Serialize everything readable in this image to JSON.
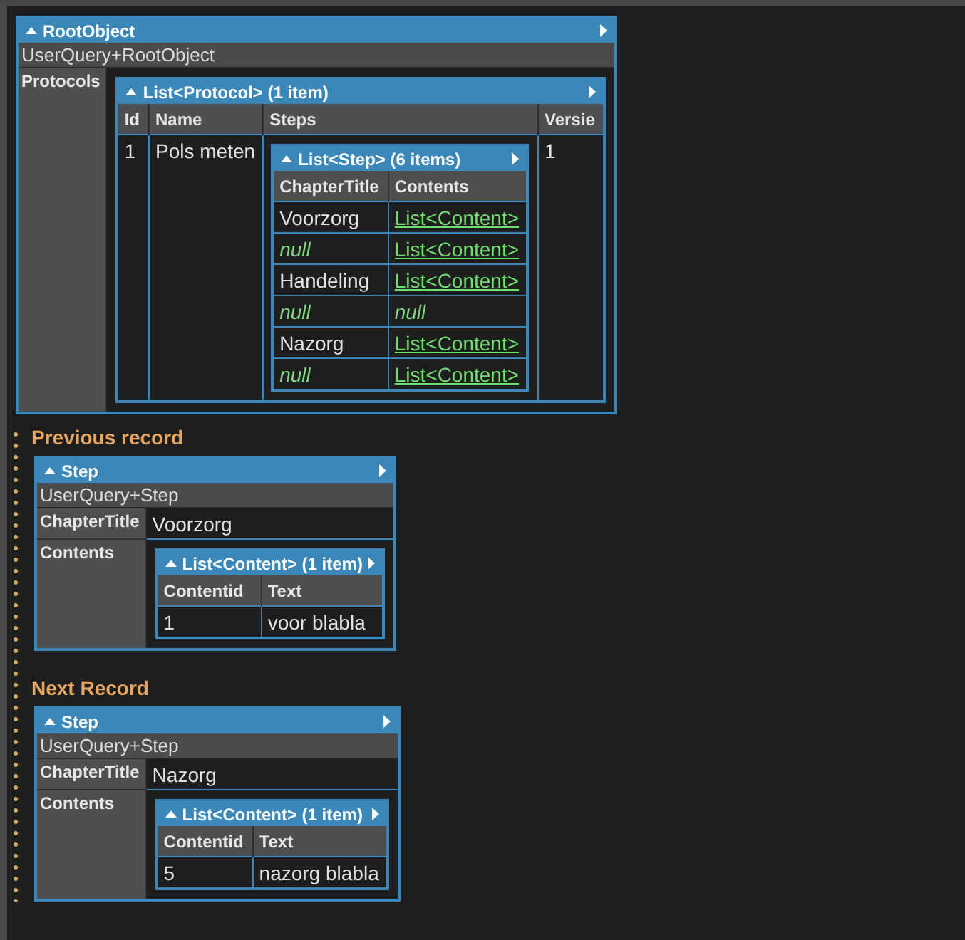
{
  "root": {
    "kind": "object",
    "title": "RootObject",
    "expanded": true,
    "type_name": "UserQuery+RootObject",
    "fields": [
      {
        "name": "Protocols",
        "value": {
          "kind": "table",
          "title": "List<Protocol> (1 item)",
          "expanded": true,
          "columns": [
            "Id",
            "Name",
            "Steps",
            "Versie"
          ],
          "rows": [
            [
              {
                "kind": "text",
                "text": "1"
              },
              {
                "kind": "text",
                "text": "Pols meten"
              },
              {
                "kind": "table",
                "title": "List<Step> (6 items)",
                "expanded": true,
                "columns": [
                  "ChapterTitle",
                  "Contents"
                ],
                "rows": [
                  [
                    {
                      "kind": "text",
                      "text": "Voorzorg"
                    },
                    {
                      "kind": "link",
                      "text": "List<Content>"
                    }
                  ],
                  [
                    {
                      "kind": "null",
                      "text": "null"
                    },
                    {
                      "kind": "link",
                      "text": "List<Content>"
                    }
                  ],
                  [
                    {
                      "kind": "text",
                      "text": "Handeling"
                    },
                    {
                      "kind": "link",
                      "text": "List<Content>"
                    }
                  ],
                  [
                    {
                      "kind": "null",
                      "text": "null"
                    },
                    {
                      "kind": "null",
                      "text": "null"
                    }
                  ],
                  [
                    {
                      "kind": "text",
                      "text": "Nazorg"
                    },
                    {
                      "kind": "link",
                      "text": "List<Content>"
                    }
                  ],
                  [
                    {
                      "kind": "null",
                      "text": "null"
                    },
                    {
                      "kind": "link",
                      "text": "List<Content>"
                    }
                  ]
                ]
              },
              {
                "kind": "text",
                "text": "1"
              }
            ]
          ]
        }
      }
    ]
  },
  "records": [
    {
      "heading": "Previous record",
      "object": {
        "kind": "object",
        "title": "Step",
        "expanded": true,
        "type_name": "UserQuery+Step",
        "fields": [
          {
            "name": "ChapterTitle",
            "value": {
              "kind": "text",
              "text": "Voorzorg"
            }
          },
          {
            "name": "Contents",
            "value": {
              "kind": "table",
              "title": "List<Content> (1 item)",
              "expanded": true,
              "columns": [
                "Contentid",
                "Text"
              ],
              "rows": [
                [
                  {
                    "kind": "text",
                    "text": "1"
                  },
                  {
                    "kind": "text",
                    "text": "voor blabla"
                  }
                ]
              ]
            }
          }
        ]
      }
    },
    {
      "heading": "Next Record",
      "object": {
        "kind": "object",
        "title": "Step",
        "expanded": true,
        "type_name": "UserQuery+Step",
        "fields": [
          {
            "name": "ChapterTitle",
            "value": {
              "kind": "text",
              "text": "Nazorg"
            }
          },
          {
            "name": "Contents",
            "value": {
              "kind": "table",
              "title": "List<Content> (1 item)",
              "expanded": true,
              "columns": [
                "Contentid",
                "Text"
              ],
              "rows": [
                [
                  {
                    "kind": "text",
                    "text": "5"
                  },
                  {
                    "kind": "text",
                    "text": "nazorg blabla"
                  }
                ]
              ]
            }
          }
        ]
      }
    }
  ]
}
